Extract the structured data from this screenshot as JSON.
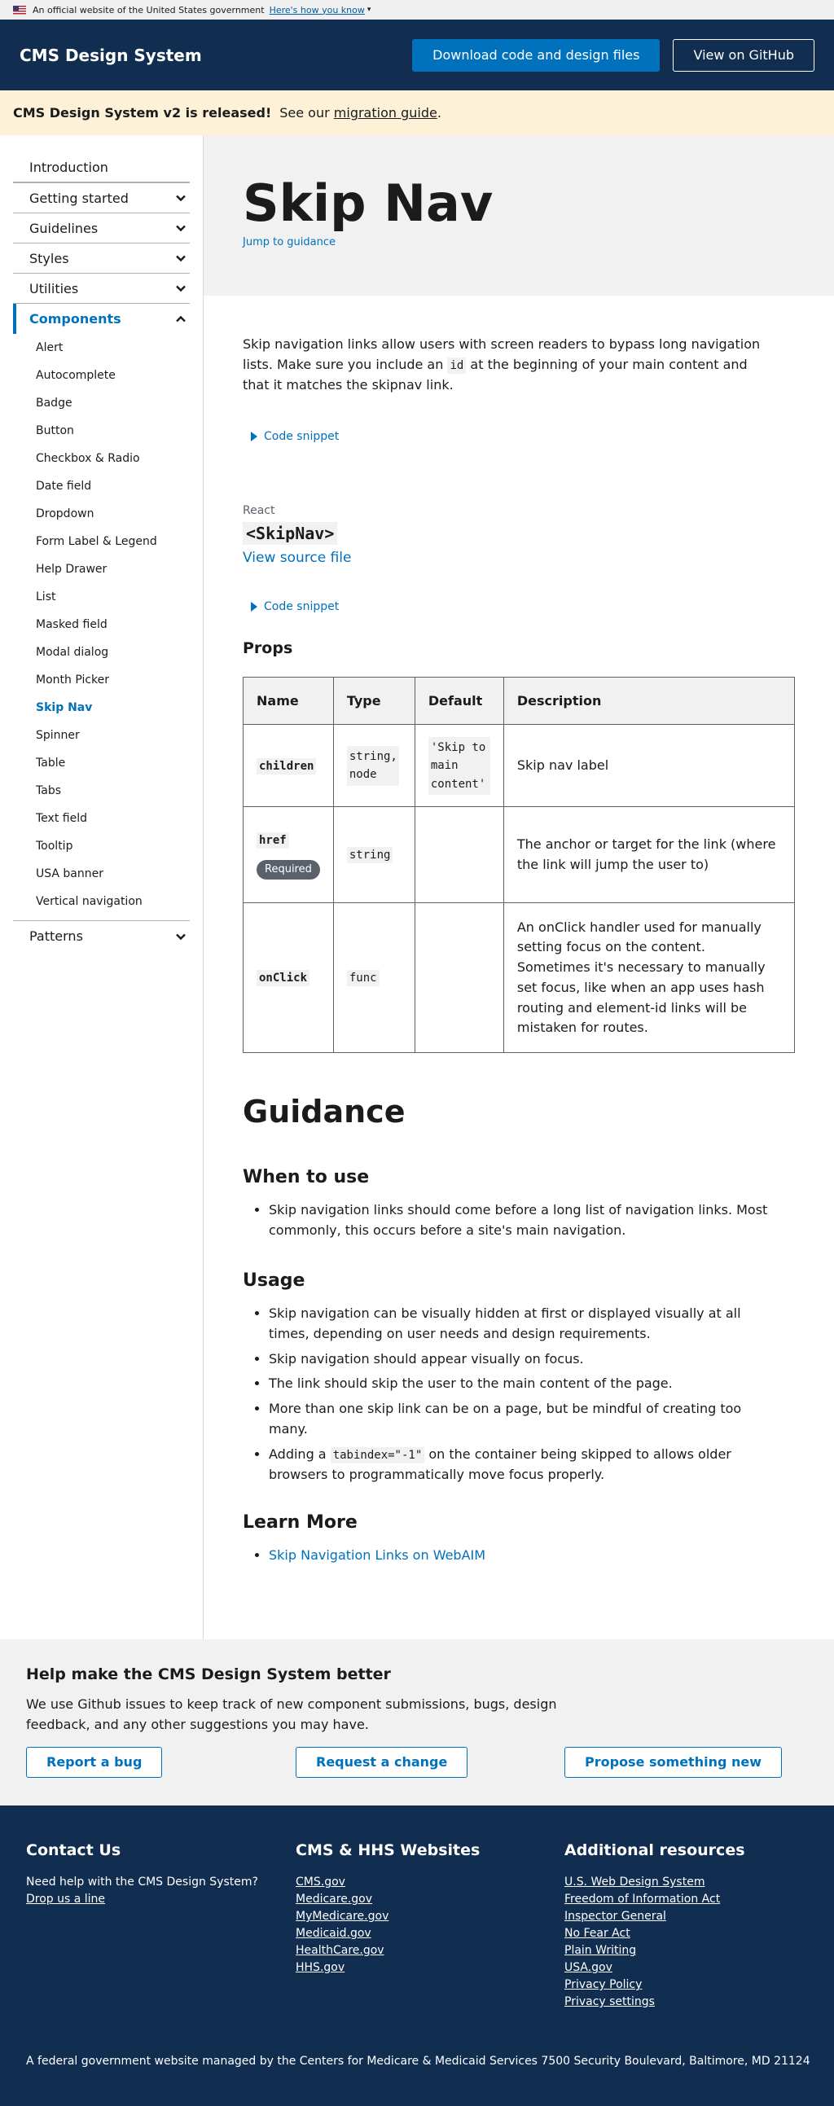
{
  "gov_banner": {
    "text": "An official website of the United States government",
    "link": "Here's how you know"
  },
  "header": {
    "title": "CMS Design System",
    "download_btn": "Download code and design files",
    "github_btn": "View on GitHub"
  },
  "alert": {
    "strong": "CMS Design System v2 is released!",
    "pre": "See our",
    "link": "migration guide",
    "post": "."
  },
  "sidenav": {
    "top_items": [
      {
        "label": "Introduction"
      },
      {
        "label": "Getting started"
      },
      {
        "label": "Guidelines"
      },
      {
        "label": "Styles"
      },
      {
        "label": "Utilities"
      },
      {
        "label": "Components"
      }
    ],
    "components": [
      "Alert",
      "Autocomplete",
      "Badge",
      "Button",
      "Checkbox & Radio",
      "Date field",
      "Dropdown",
      "Form Label & Legend",
      "Help Drawer",
      "List",
      "Masked field",
      "Modal dialog",
      "Month Picker",
      "Skip Nav",
      "Spinner",
      "Table",
      "Tabs",
      "Text field",
      "Tooltip",
      "USA banner",
      "Vertical navigation"
    ],
    "patterns": "Patterns"
  },
  "hero": {
    "title": "Skip Nav",
    "jump_link": "Jump to guidance"
  },
  "intro": {
    "p1": "Skip navigation links allow users with screen readers to bypass long navigation lists. Make sure you include an",
    "code": "id",
    "p2": "at the beginning of your main content and that it matches the skipnav link."
  },
  "code_snippet_label": "Code snippet",
  "react": {
    "label": "React",
    "component": "<SkipNav>",
    "source_link": "View source file"
  },
  "props": {
    "heading": "Props",
    "headers": [
      "Name",
      "Type",
      "Default",
      "Description"
    ],
    "rows": [
      {
        "name": "children",
        "type": "string, node",
        "default": "'Skip to main content'",
        "desc": "Skip nav label"
      },
      {
        "name": "href",
        "badge": "Required",
        "type": "string",
        "default": "",
        "desc": "The anchor or target for the link (where the link will jump the user to)"
      },
      {
        "name": "onClick",
        "type": "func",
        "default": "",
        "desc": "An onClick handler used for manually setting focus on the content. Sometimes it's necessary to manually set focus, like when an app uses hash routing and element-id links will be mistaken for routes."
      }
    ]
  },
  "guidance": {
    "heading": "Guidance",
    "when_heading": "When to use",
    "when_items": [
      "Skip navigation links should come before a long list of navigation links. Most commonly, this occurs before a site's main navigation."
    ],
    "usage_heading": "Usage",
    "usage_items": [
      "Skip navigation can be visually hidden at first or displayed visually at all times, depending on user needs and design requirements.",
      "Skip navigation should appear visually on focus.",
      "The link should skip the user to the main content of the page.",
      "More than one skip link can be on a page, but be mindful of creating too many."
    ],
    "usage_last": {
      "pre": "Adding a",
      "code": "tabindex=\"-1\"",
      "post": "on the container being skipped to allows older browsers to programmatically move focus properly."
    },
    "learn_heading": "Learn More",
    "learn_link": "Skip Navigation Links on WebAIM"
  },
  "feedback": {
    "heading": "Help make the CMS Design System better",
    "text": "We use Github issues to keep track of new component submissions, bugs, design feedback, and any other suggestions you may have.",
    "buttons": [
      "Report a bug",
      "Request a change",
      "Propose something new"
    ]
  },
  "footer": {
    "contact_heading": "Contact Us",
    "contact_text": "Need help with the CMS Design System?",
    "contact_link": "Drop us a line",
    "websites_heading": "CMS & HHS Websites",
    "websites": [
      "CMS.gov",
      "Medicare.gov",
      "MyMedicare.gov",
      "Medicaid.gov",
      "HealthCare.gov",
      "HHS.gov"
    ],
    "resources_heading": "Additional resources",
    "resources": [
      "U.S. Web Design System",
      "Freedom of Information Act",
      "Inspector General",
      "No Fear Act",
      "Plain Writing",
      "USA.gov",
      "Privacy Policy",
      "Privacy settings"
    ],
    "note": "A federal government website managed by the Centers for Medicare & Medicaid Services 7500 Security Boulevard, Baltimore, MD 21124"
  }
}
